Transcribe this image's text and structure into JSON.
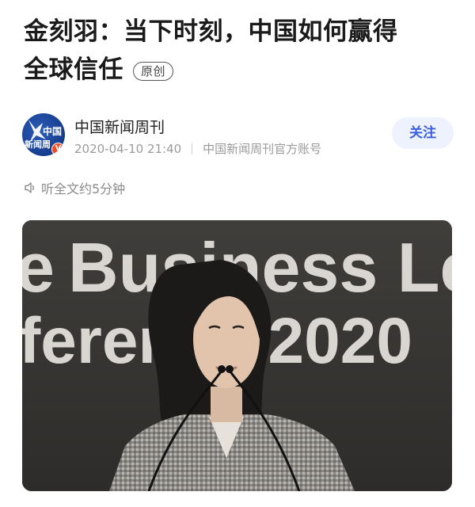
{
  "article": {
    "title_line1": "金刻羽：当下时刻，中国如何赢得",
    "title_line2": "全球信任",
    "original_badge": "原创"
  },
  "author": {
    "name": "中国新闻周刊",
    "date": "2020-04-10 21:40",
    "account": "中国新闻周刊官方账号",
    "avatar_text_1": "中国",
    "avatar_text_2": "新闻周",
    "verified_mark": "V",
    "follow_label": "关注"
  },
  "listen": {
    "icon": "speaker-icon",
    "label": "听全文约5分钟"
  },
  "hero_image": {
    "backdrop_line1": "Business Le",
    "backdrop_line1_prefix": "e",
    "backdrop_line2": "ference 2020",
    "background_color": "#3d3b39"
  },
  "colors": {
    "accent": "#3a5fd9",
    "follow_bg": "#eef2ff",
    "verified": "#f04a23",
    "muted": "#9a9a9a"
  }
}
